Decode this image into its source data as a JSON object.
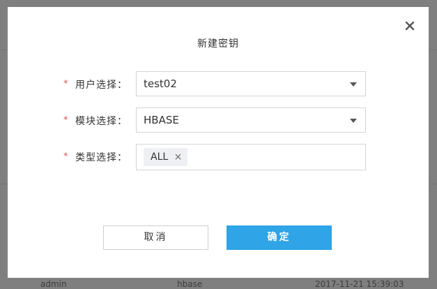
{
  "dialog": {
    "title": "新建密钥",
    "close_icon": "close-icon"
  },
  "form": {
    "required_mark": "*",
    "user": {
      "label": "用户选择：",
      "value": "test02"
    },
    "module": {
      "label": "模块选择：",
      "value": "HBASE"
    },
    "type": {
      "label": "类型选择：",
      "tags": [
        {
          "label": "ALL",
          "remove_glyph": "×"
        }
      ]
    }
  },
  "buttons": {
    "cancel": "取消",
    "ok": "确定"
  },
  "background_row": {
    "user": "admin",
    "module": "hbase",
    "time": "2017-11-21 15:39:03"
  },
  "colors": {
    "primary": "#2fa4e7",
    "required": "#e25252",
    "overlay": "#7f7f7f"
  }
}
